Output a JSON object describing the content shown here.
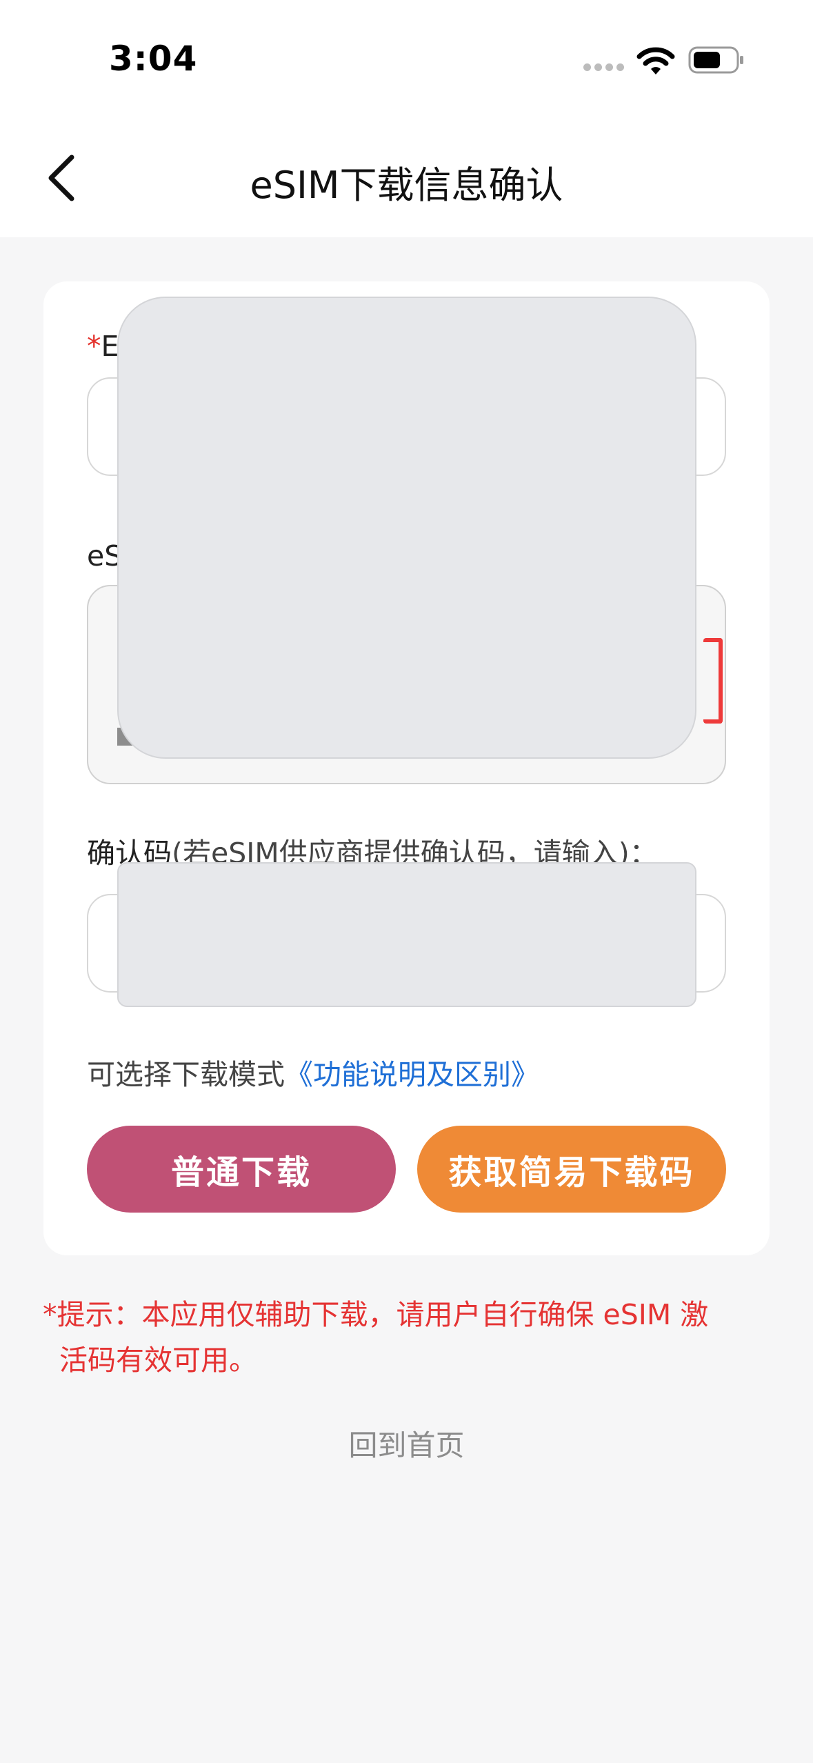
{
  "status_bar": {
    "time": "3:04",
    "icons": [
      "signal-dots-icon",
      "wifi-icon",
      "battery-icon"
    ]
  },
  "header": {
    "title": "eSIM下载信息确认",
    "back_icon": "chevron-left-icon"
  },
  "form": {
    "field1": {
      "required_mark": "*",
      "label_visible": "E"
    },
    "field2": {
      "label_visible": "eS"
    },
    "confirm_code": {
      "label": "确认码",
      "hint": "(若eSIM供应商提供确认码，请输入)："
    },
    "mode": {
      "prefix": "可选择下载模式",
      "link": "《功能说明及区别》"
    },
    "buttons": {
      "normal": "普通下载",
      "simple": "获取简易下载码"
    }
  },
  "tip": {
    "line1": "*提示：本应用仅辅助下载，请用户自行确保 eSIM 激",
    "line2": "活码有效可用。"
  },
  "footer": {
    "home_link": "回到首页"
  },
  "colors": {
    "primary_button": "#c05175",
    "secondary_button": "#ef8a36",
    "link": "#1f6fd6",
    "warning": "#e53333"
  }
}
